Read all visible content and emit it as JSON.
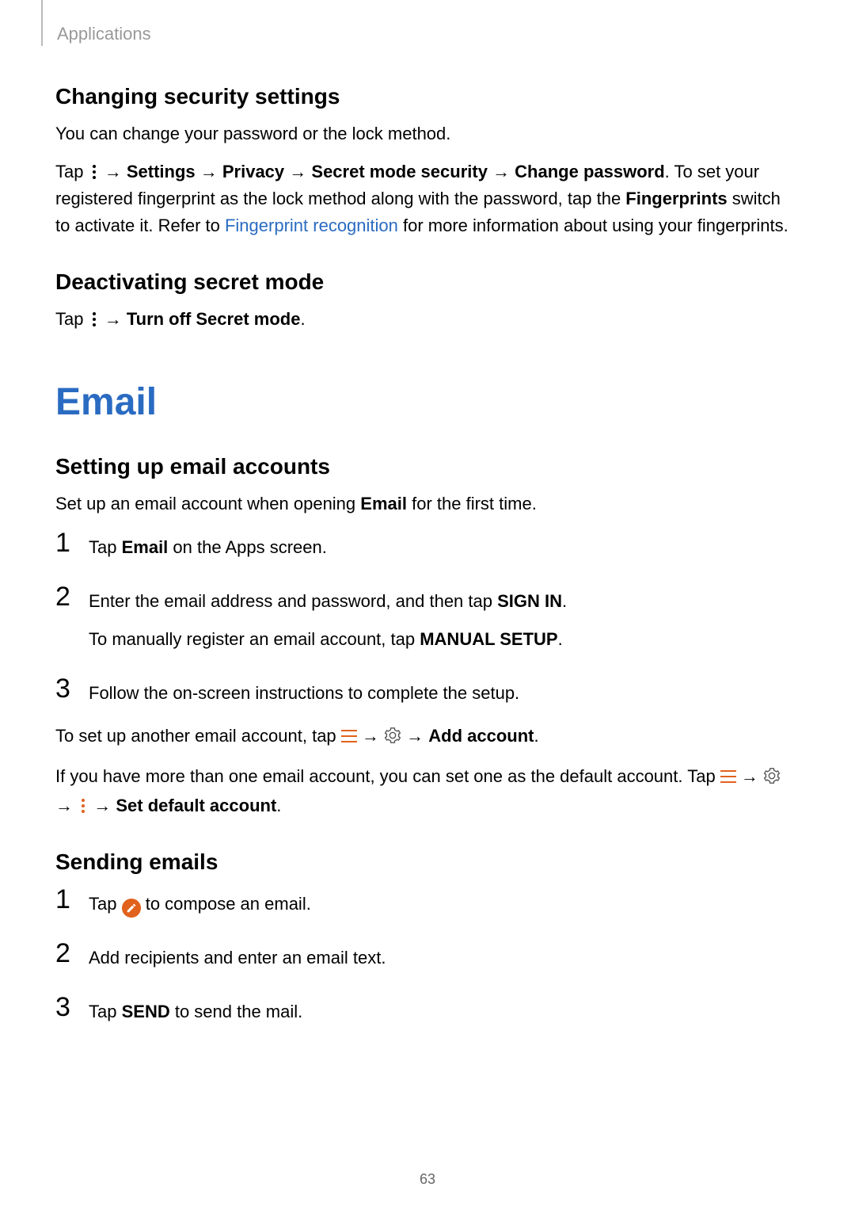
{
  "header": {
    "section": "Applications"
  },
  "sec1": {
    "title": "Changing security settings",
    "intro": "You can change your password or the lock method.",
    "p2_a": "Tap ",
    "p2_b": " → ",
    "p2_settings": "Settings",
    "p2_c": " → ",
    "p2_privacy": "Privacy",
    "p2_d": " → ",
    "p2_sms": "Secret mode security",
    "p2_e": " → ",
    "p2_cp": "Change password",
    "p2_f": ". To set your registered fingerprint as the lock method along with the password, tap the ",
    "p2_fp": "Fingerprints",
    "p2_g": " switch to activate it. Refer to ",
    "p2_link": "Fingerprint recognition",
    "p2_h": " for more information about using your fingerprints."
  },
  "sec2": {
    "title": "Deactivating secret mode",
    "p_a": "Tap ",
    "p_b": " → ",
    "p_bold": "Turn off Secret mode",
    "p_c": "."
  },
  "email_h1": "Email",
  "sec3": {
    "title": "Setting up email accounts",
    "intro_a": "Set up an email account when opening ",
    "intro_email": "Email",
    "intro_b": " for the first time.",
    "steps": [
      {
        "a": "Tap ",
        "bold": "Email",
        "b": " on the Apps screen."
      },
      {
        "line1_a": "Enter the email address and password, and then tap ",
        "line1_bold": "SIGN IN",
        "line1_b": ".",
        "line2_a": "To manually register an email account, tap ",
        "line2_bold": "MANUAL SETUP",
        "line2_b": "."
      },
      {
        "a": "Follow the on-screen instructions to complete the setup."
      }
    ],
    "p2_a": "To set up another email account, tap ",
    "p2_b": " → ",
    "p2_c": " → ",
    "p2_bold": "Add account",
    "p2_d": ".",
    "p3_a": "If you have more than one email account, you can set one as the default account. Tap ",
    "p3_b": " → ",
    "p3_c": " → ",
    "p3_d": " → ",
    "p3_bold": "Set default account",
    "p3_e": "."
  },
  "sec4": {
    "title": "Sending emails",
    "steps": [
      {
        "a": "Tap ",
        "b": " to compose an email."
      },
      {
        "a": "Add recipients and enter an email text."
      },
      {
        "a": "Tap ",
        "bold": "SEND",
        "b": " to send the mail."
      }
    ]
  },
  "page_number": "63",
  "chart_data": null
}
